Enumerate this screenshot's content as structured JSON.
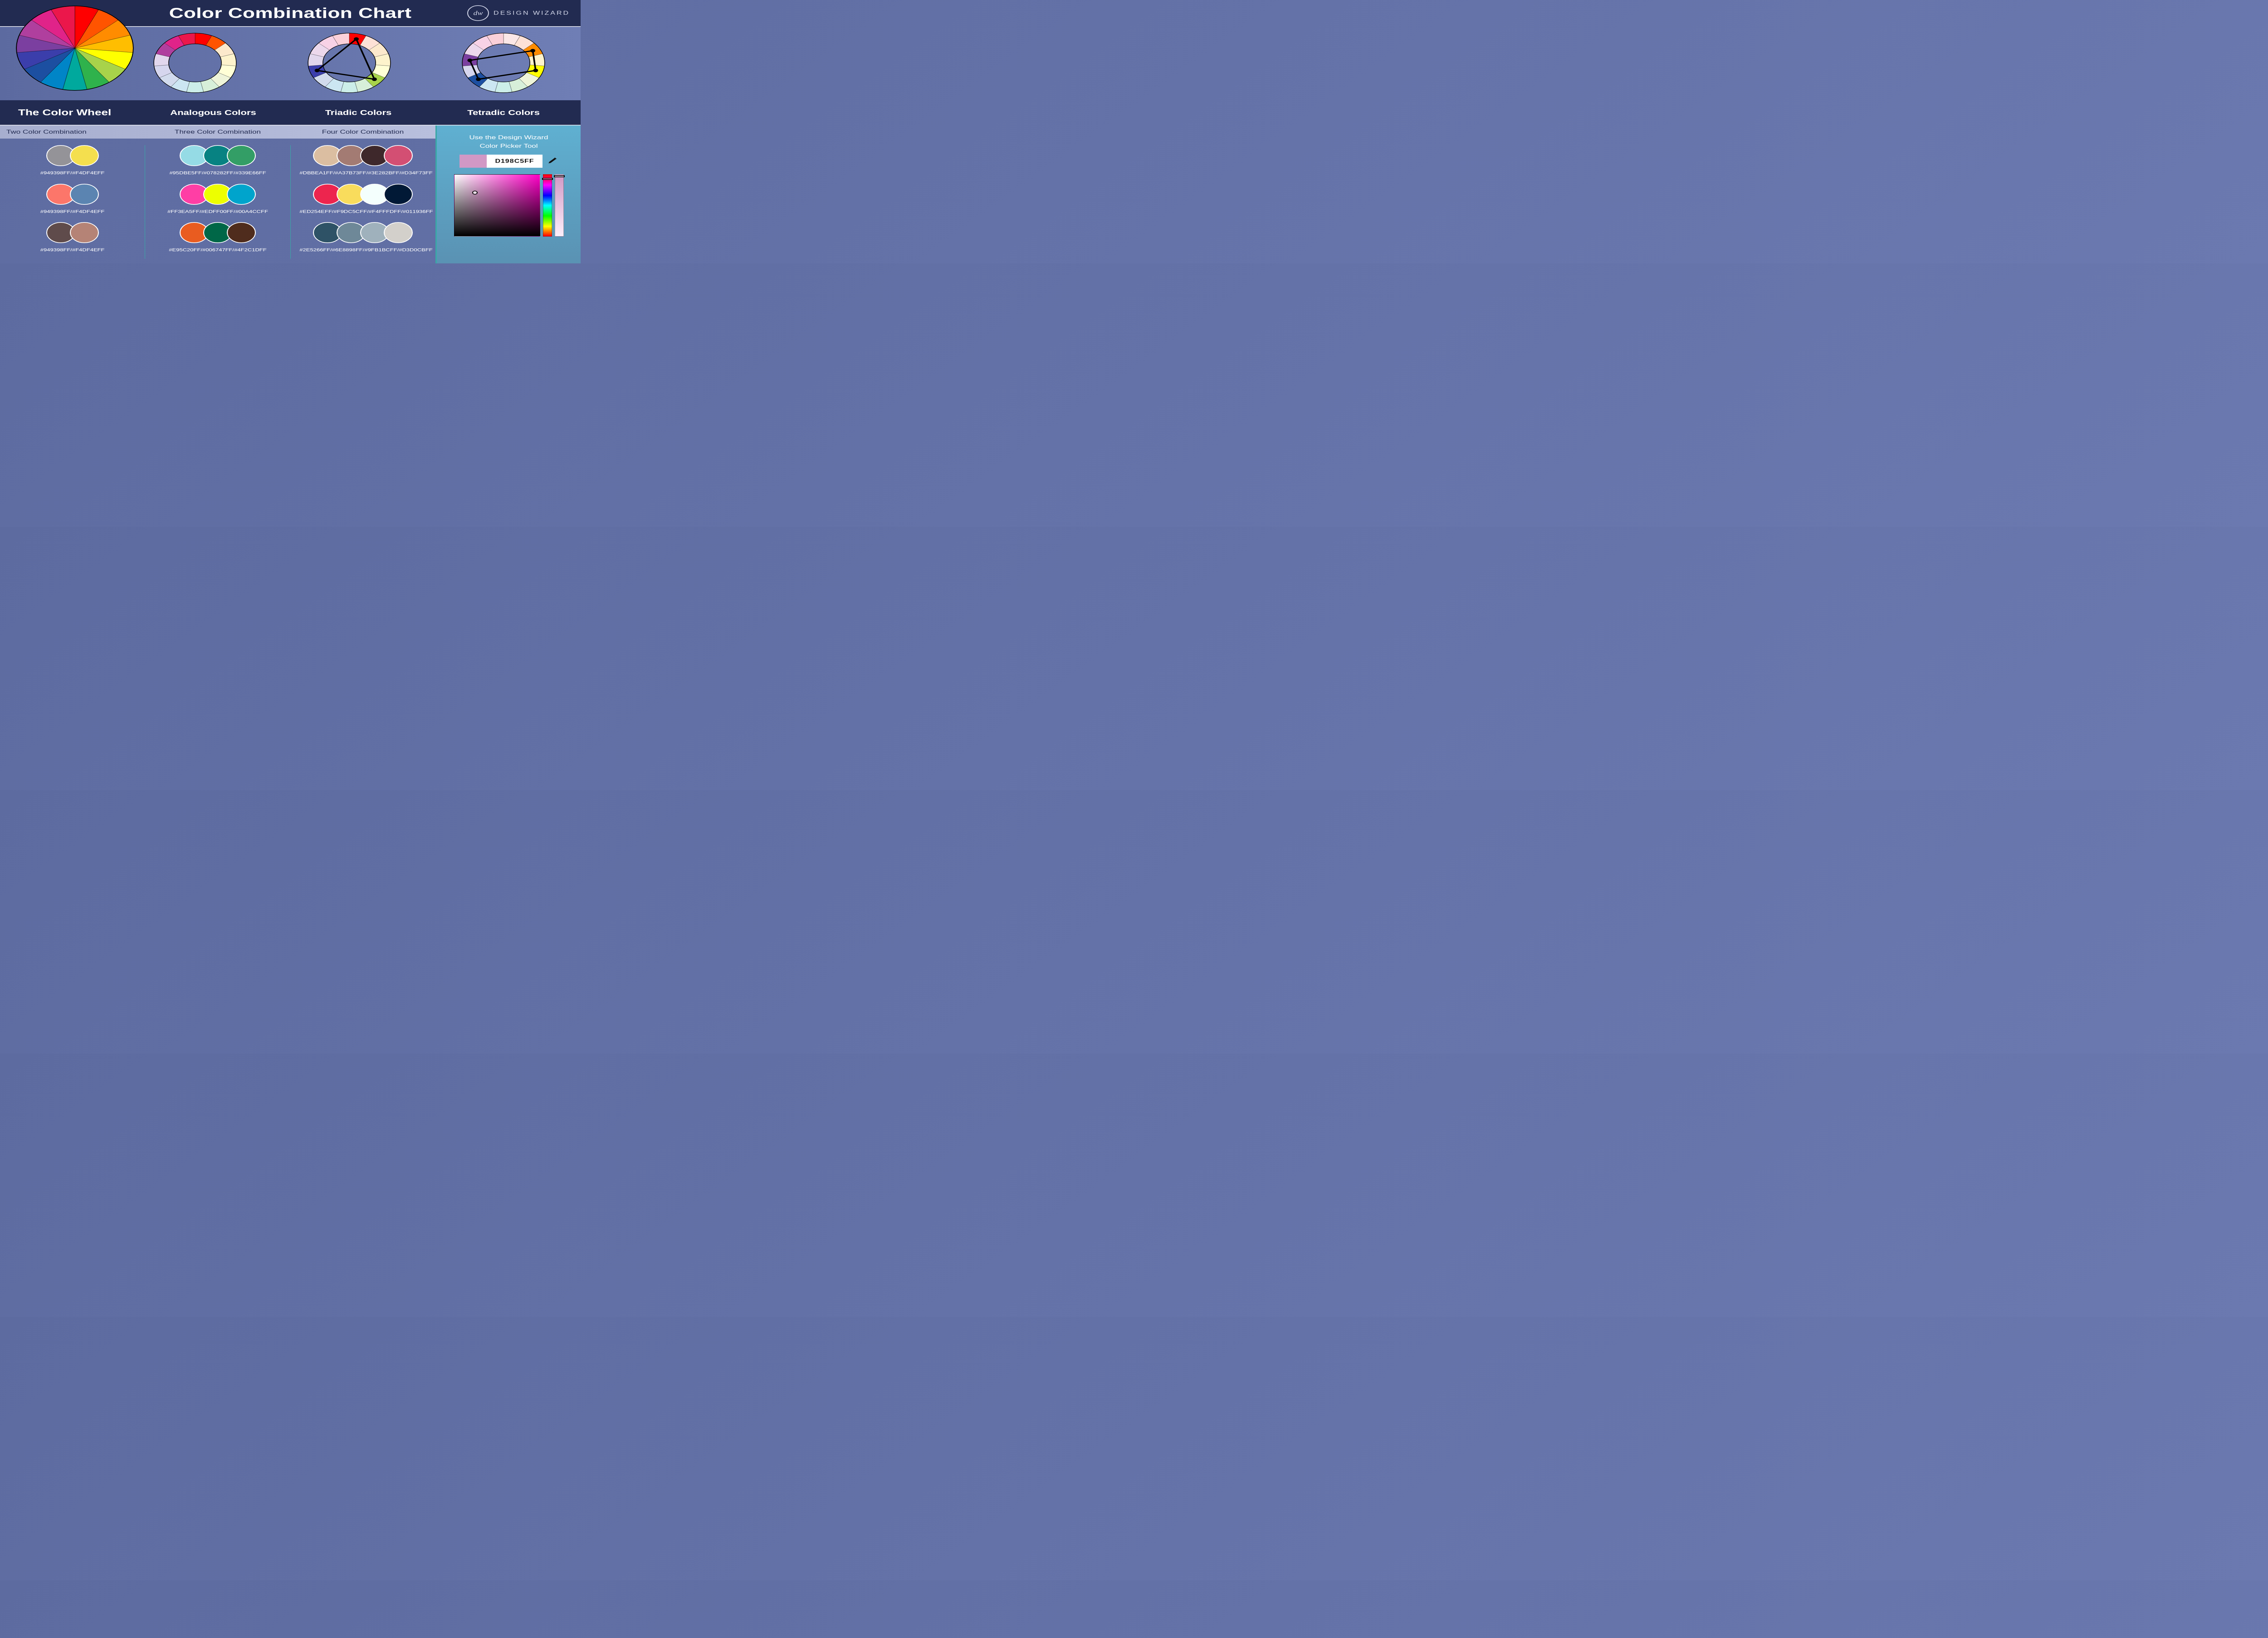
{
  "header": {
    "title": "Color Combination Chart",
    "brand": "DESIGN WIZARD",
    "brand_mono": "dw"
  },
  "section_labels": {
    "wheel": "The Color Wheel",
    "analogous": "Analogous Colors",
    "triadic": "Triadic Colors",
    "tetradic": "Tetradic Colors"
  },
  "wheel_colors": [
    "#FF0000",
    "#FF5400",
    "#FF8C00",
    "#FFBE00",
    "#FFFF00",
    "#A8D34A",
    "#2FB24C",
    "#00A99D",
    "#0085C7",
    "#1C4FA1",
    "#3B3EAB",
    "#7B3FA0",
    "#B03F9E",
    "#E02389",
    "#EB174B"
  ],
  "ring_faded": [
    "#fbe7e7",
    "#fde1d6",
    "#fce9cc",
    "#fdf3cc",
    "#ffffd6",
    "#eef4d9",
    "#d7efd9",
    "#cceee9",
    "#cce6f2",
    "#d2dbed",
    "#d6d6ee",
    "#e2d7ed",
    "#ecd8ec",
    "#f8d2e6",
    "#fbd0d9"
  ],
  "analogous_highlight": [
    12,
    13,
    14,
    0,
    1
  ],
  "triadic_indices": [
    0,
    5,
    10
  ],
  "tetradic_indices": [
    2,
    4,
    9,
    11
  ],
  "tabs": {
    "two": "Two Color Combination",
    "three": "Three Color Combination",
    "four": "Four Color Combination"
  },
  "combos": {
    "two": [
      {
        "colors": [
          "#949398",
          "#F4DF4E"
        ],
        "label": "#949398FF/#F4DF4EFF"
      },
      {
        "colors": [
          "#FC766A",
          "#5B84B1"
        ],
        "label": "#949398FF/#F4DF4EFF"
      },
      {
        "colors": [
          "#5F4B4B",
          "#B58376"
        ],
        "label": "#949398FF/#F4DF4EFF"
      }
    ],
    "three": [
      {
        "colors": [
          "#95DBE5",
          "#078282",
          "#339E66"
        ],
        "label": "#95DBE5FF/#078282FF/#339E66FF"
      },
      {
        "colors": [
          "#FF3EA5",
          "#EDFF00",
          "#00A4CC"
        ],
        "label": "#FF3EA5FF/#EDFF00FF/#00A4CCFF"
      },
      {
        "colors": [
          "#E95C20",
          "#006747",
          "#4F2C1D"
        ],
        "label": "#E95C20FF/#006747FF/#4F2C1DFF"
      }
    ],
    "four": [
      {
        "colors": [
          "#DBBEA1",
          "#A37B73",
          "#3E282B",
          "#D34F73"
        ],
        "label": "#DBBEA1FF/#A37B73FF/#3E282BFF/#D34F73FF"
      },
      {
        "colors": [
          "#ED254E",
          "#F9DC5C",
          "#F4FFFD",
          "#011936"
        ],
        "label": "#ED254EFF/#F9DC5CFF/#F4FFFDFF/#011936FF"
      },
      {
        "colors": [
          "#2E5266",
          "#6E8898",
          "#9FB1BC",
          "#D3D0CB"
        ],
        "label": "#2E5266FF/#6E8898FF/#9FB1BCFF/#D3D0CBFF"
      }
    ]
  },
  "picker": {
    "cta_line1": "Use the Design Wizard",
    "cta_line2": "Color Picker Tool",
    "hex": "D198C5FF",
    "swatch": "#D198C5"
  }
}
